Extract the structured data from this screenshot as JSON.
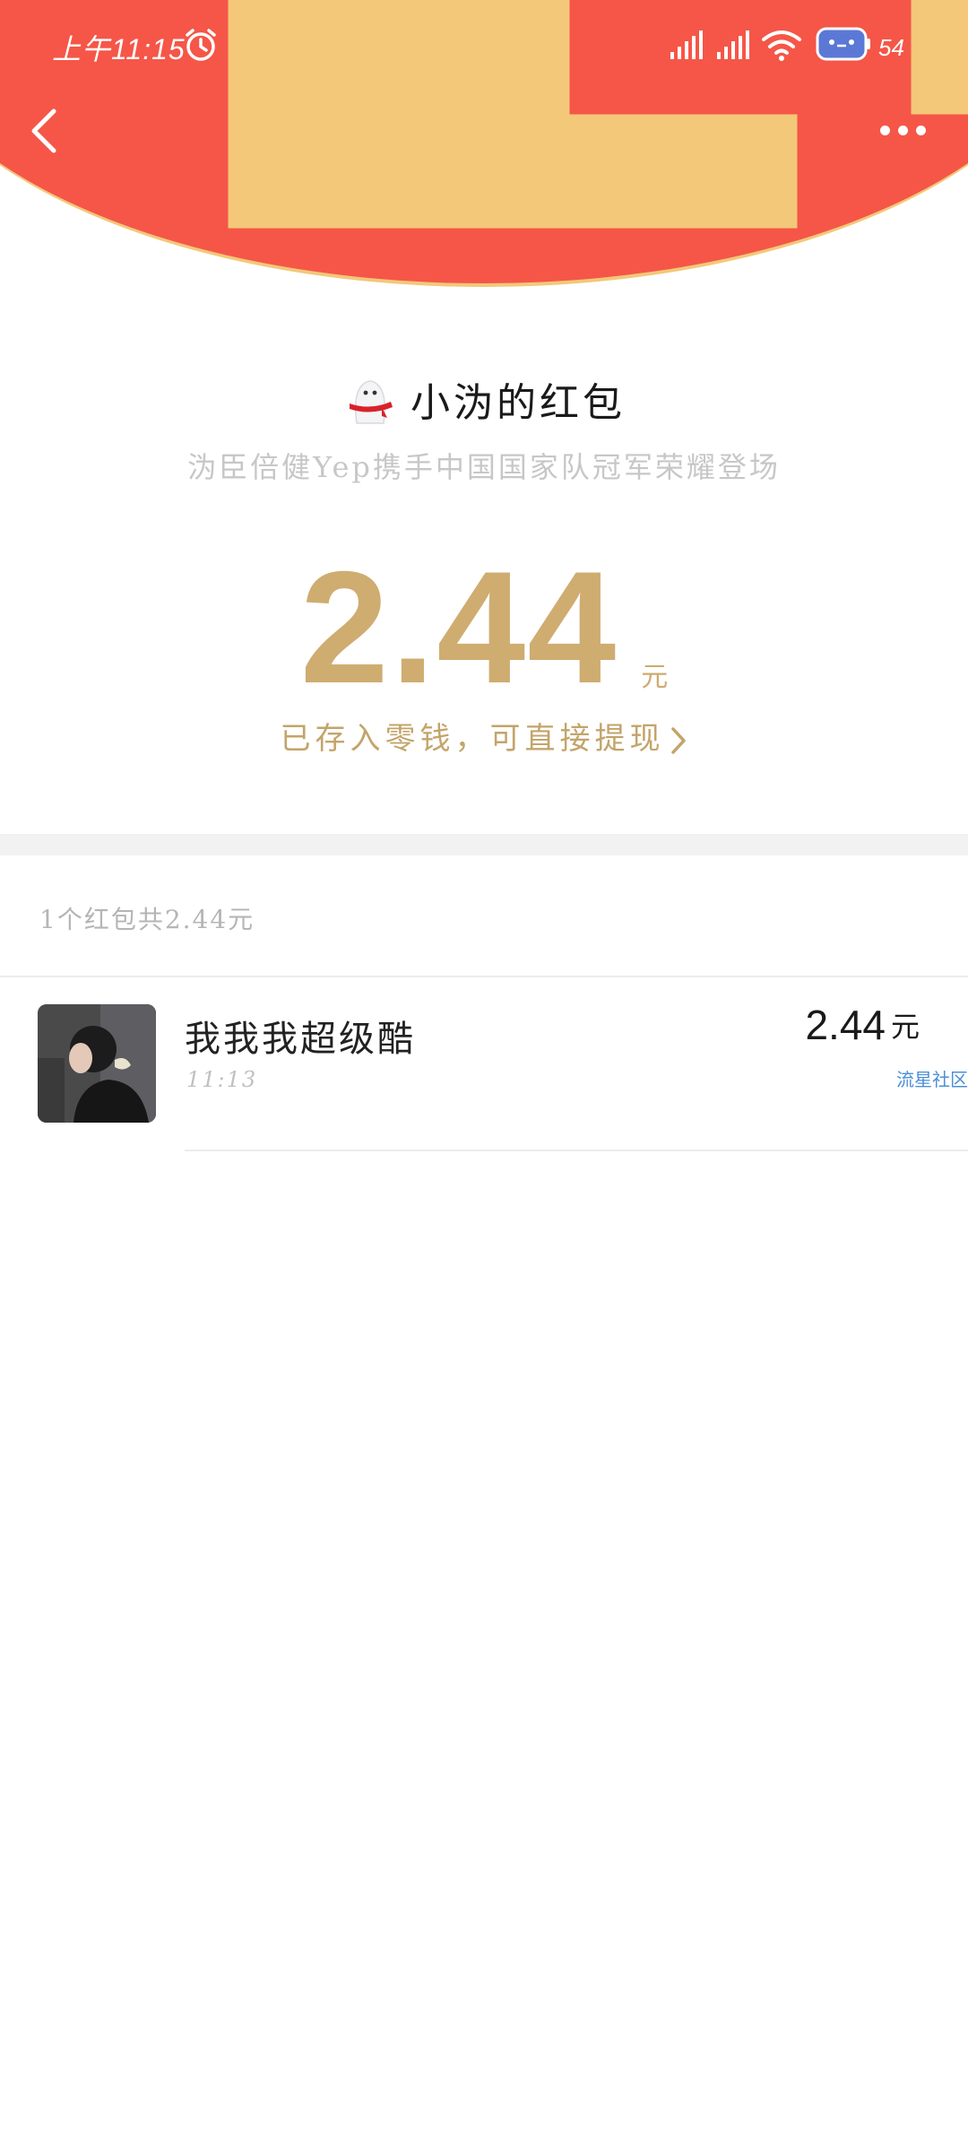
{
  "status_bar": {
    "time": "上午11:15",
    "battery": "54"
  },
  "nav": {
    "back_icon": "chevron-left-icon",
    "more_icon": "more-horizontal-icon"
  },
  "packet": {
    "sender": "小沩的红包",
    "greeting": "沩臣倍健Yep携手中国国家队冠军荣耀登场",
    "amount": "2.44",
    "unit": "元",
    "withdraw_note": "已存入零钱，可直接提现"
  },
  "summary": "1个红包共2.44元",
  "records": [
    {
      "name": "我我我超级酷",
      "time": "11:13",
      "amount": "2.44",
      "unit": "元",
      "tag": "流星社区"
    }
  ],
  "colors": {
    "header_red": "#f55648",
    "header_border": "#f3c879",
    "gold": "#cfac70",
    "link_blue": "#4b8fd6"
  }
}
